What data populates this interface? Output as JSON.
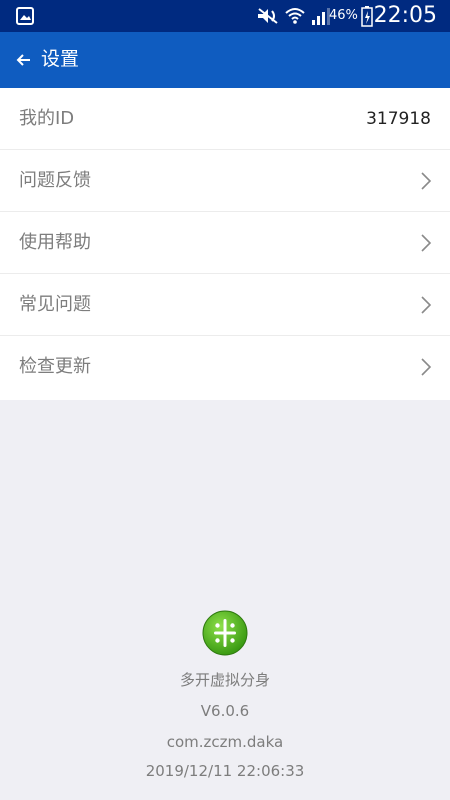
{
  "status_bar": {
    "battery_percent": "46%",
    "time": "22:05",
    "icons": [
      "image-icon",
      "mute-icon",
      "wifi-icon",
      "signal-icon",
      "battery-charging-icon"
    ]
  },
  "header": {
    "title": "设置"
  },
  "settings": {
    "id_label": "我的ID",
    "id_value": "317918",
    "items": [
      {
        "label": "问题反馈"
      },
      {
        "label": "使用帮助"
      },
      {
        "label": "常见问题"
      },
      {
        "label": "检查更新"
      }
    ]
  },
  "app_info": {
    "name": "多开虚拟分身",
    "version": "V6.0.6",
    "package": "com.zczm.daka",
    "build_time": "2019/12/11 22:06:33"
  },
  "colors": {
    "status_bar": "#002a80",
    "app_bar": "#0f5cc0",
    "background": "#efeff4",
    "logo_green": "#5cbf1e"
  }
}
